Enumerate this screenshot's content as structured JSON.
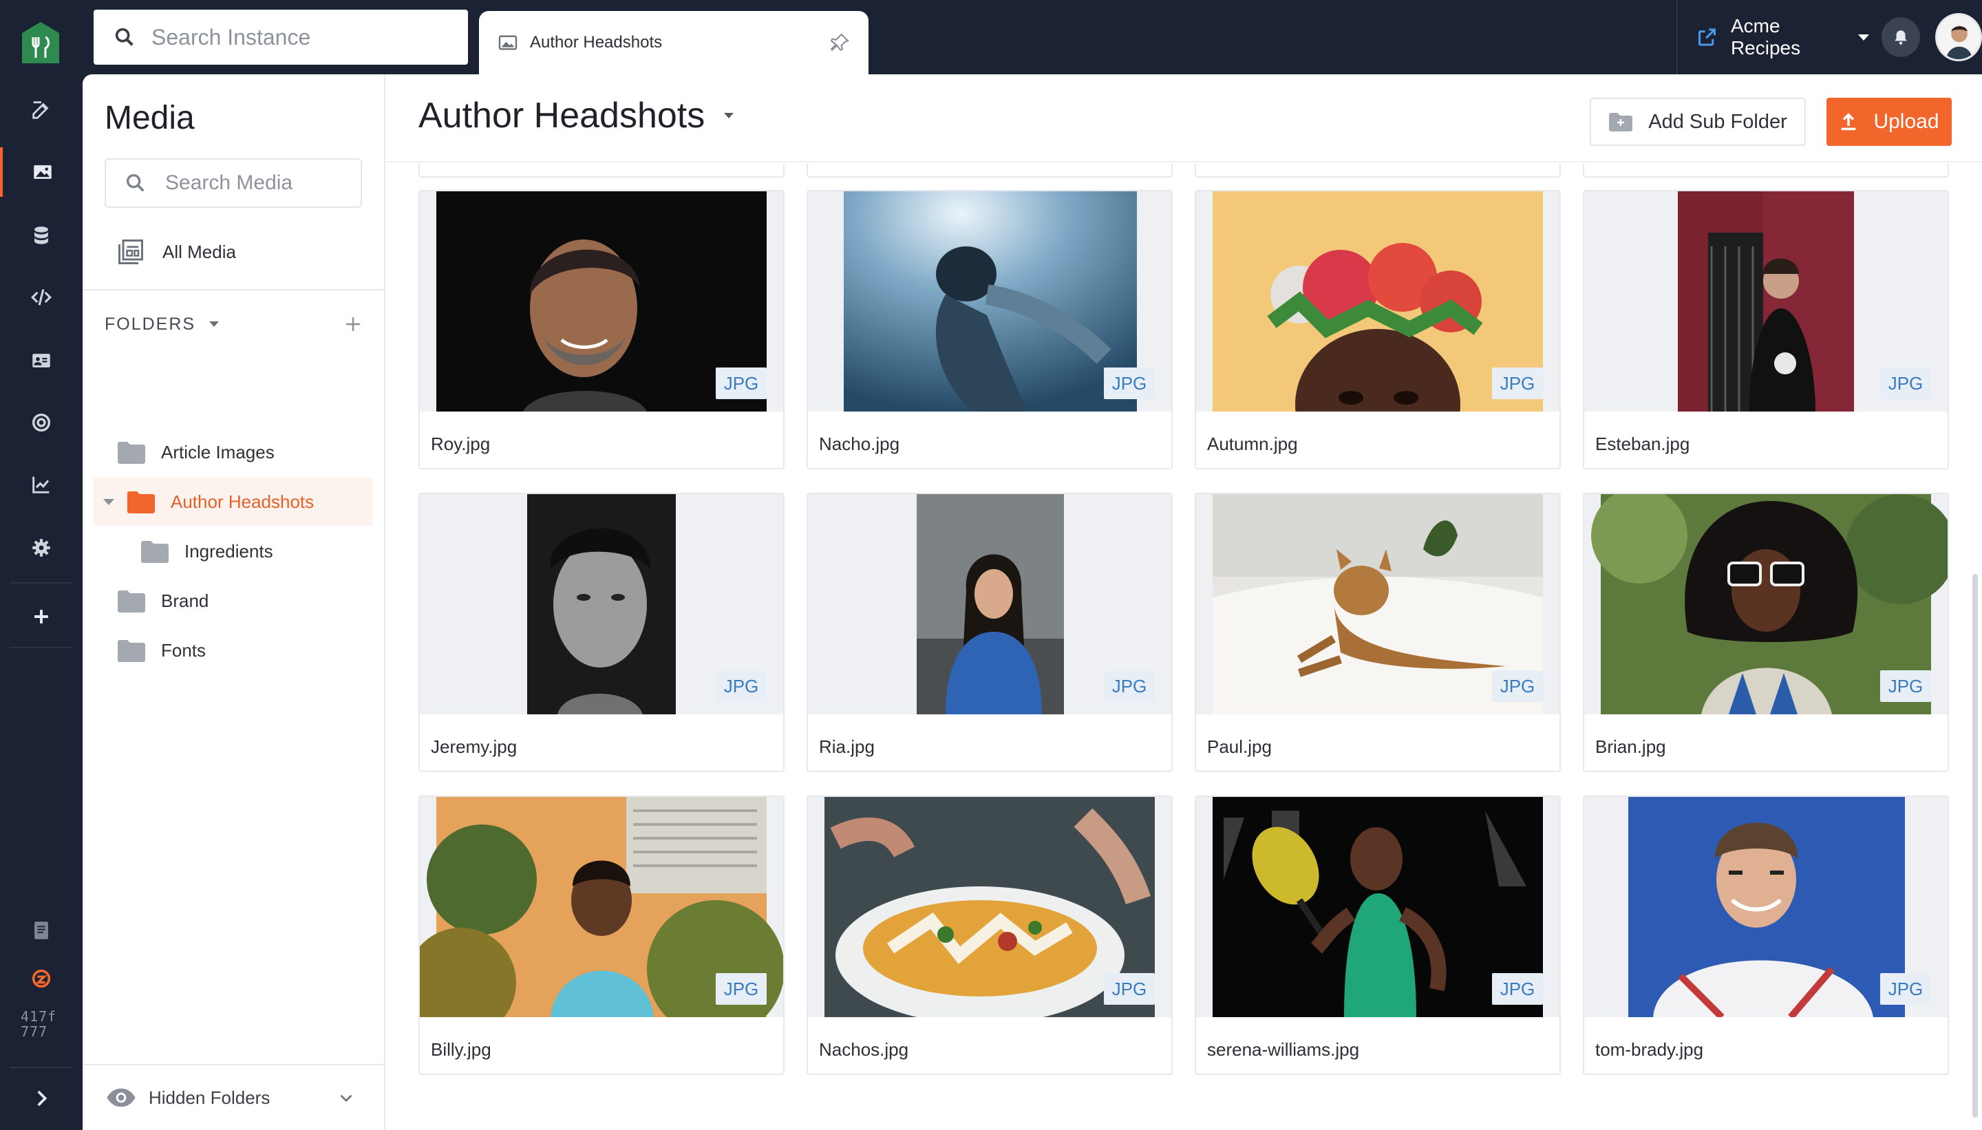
{
  "app": {
    "search_placeholder": "Search Instance",
    "instance_name": "Acme Recipes",
    "build_hash": "417f\n777"
  },
  "tab": {
    "label": "Author Headshots"
  },
  "sidebar": {
    "title": "Media",
    "search_placeholder": "Search Media",
    "all_media_label": "All Media",
    "folders_heading": "FOLDERS",
    "folders": [
      {
        "label": "Article Images",
        "active": false
      },
      {
        "label": "Author Headshots",
        "active": true
      },
      {
        "label": "Ingredients",
        "active": false
      },
      {
        "label": "Brand",
        "active": false
      },
      {
        "label": "Fonts",
        "active": false
      }
    ],
    "hidden_folders_label": "Hidden Folders"
  },
  "main": {
    "title": "Author Headshots",
    "add_sub_folder_label": "Add Sub Folder",
    "upload_label": "Upload",
    "files": [
      {
        "name": "Roy.jpg",
        "type": "JPG"
      },
      {
        "name": "Nacho.jpg",
        "type": "JPG"
      },
      {
        "name": "Autumn.jpg",
        "type": "JPG"
      },
      {
        "name": "Esteban.jpg",
        "type": "JPG"
      },
      {
        "name": "Jeremy.jpg",
        "type": "JPG"
      },
      {
        "name": "Ria.jpg",
        "type": "JPG"
      },
      {
        "name": "Paul.jpg",
        "type": "JPG"
      },
      {
        "name": "Brian.jpg",
        "type": "JPG"
      },
      {
        "name": "Billy.jpg",
        "type": "JPG"
      },
      {
        "name": "Nachos.jpg",
        "type": "JPG"
      },
      {
        "name": "serena-williams.jpg",
        "type": "JPG"
      },
      {
        "name": "tom-brady.jpg",
        "type": "JPG"
      }
    ]
  },
  "colors": {
    "rail_bg": "#1b2233",
    "accent": "#f2662b",
    "active_folder_text": "#e4622a",
    "type_badge_text": "#3a7cc0",
    "logo_green": "#2f8a4f"
  },
  "icons": {
    "rail": [
      "edit-icon",
      "media-icon",
      "database-icon",
      "code-icon",
      "contact-card-icon",
      "target-icon",
      "analytics-icon",
      "settings-icon",
      "plus-icon",
      "docs-icon",
      "zesty-logo-icon",
      "expand-icon"
    ]
  }
}
